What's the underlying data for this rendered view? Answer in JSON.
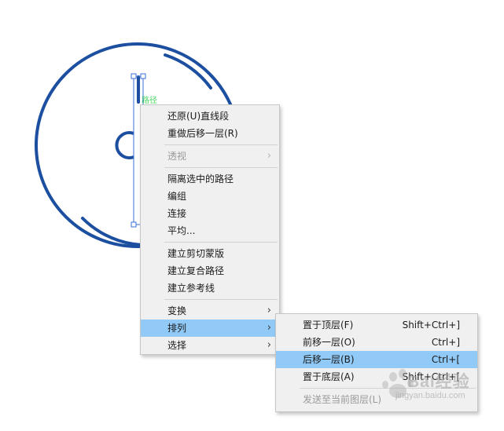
{
  "canvas": {
    "anchor_label": "路径",
    "stroke_color": "#1c4fa0",
    "selection_color": "#3a6fd8"
  },
  "context_menu": {
    "items": [
      {
        "label": "还原(U)直线段",
        "enabled": true
      },
      {
        "label": "重做后移一层(R)",
        "enabled": true
      },
      {
        "label": "透视",
        "enabled": false,
        "submenu": true
      },
      {
        "label": "隔离选中的路径",
        "enabled": true
      },
      {
        "label": "编组",
        "enabled": true
      },
      {
        "label": "连接",
        "enabled": true
      },
      {
        "label": "平均...",
        "enabled": true
      },
      {
        "label": "建立剪切蒙版",
        "enabled": true
      },
      {
        "label": "建立复合路径",
        "enabled": true
      },
      {
        "label": "建立参考线",
        "enabled": true
      },
      {
        "label": "变换",
        "enabled": true,
        "submenu": true
      },
      {
        "label": "排列",
        "enabled": true,
        "submenu": true,
        "highlighted": true
      },
      {
        "label": "选择",
        "enabled": true,
        "submenu": true
      }
    ],
    "submenu_arrow": "›"
  },
  "arrange_submenu": {
    "items": [
      {
        "label": "置于顶层(F)",
        "shortcut": "Shift+Ctrl+]",
        "enabled": true
      },
      {
        "label": "前移一层(O)",
        "shortcut": "Ctrl+]",
        "enabled": true
      },
      {
        "label": "后移一层(B)",
        "shortcut": "Ctrl+[",
        "enabled": true,
        "highlighted": true
      },
      {
        "label": "置于底层(A)",
        "shortcut": "Shift+Ctrl+[",
        "enabled": true
      },
      {
        "label": "发送至当前图层(L)",
        "shortcut": "",
        "enabled": false
      }
    ]
  },
  "colors": {
    "menu_background": "#f0f0f0",
    "highlight": "#91c9f7",
    "disabled_text": "#9a9a9a"
  },
  "watermark": {
    "text": "Bai经验",
    "sub": "jingyan.baidu.com"
  }
}
